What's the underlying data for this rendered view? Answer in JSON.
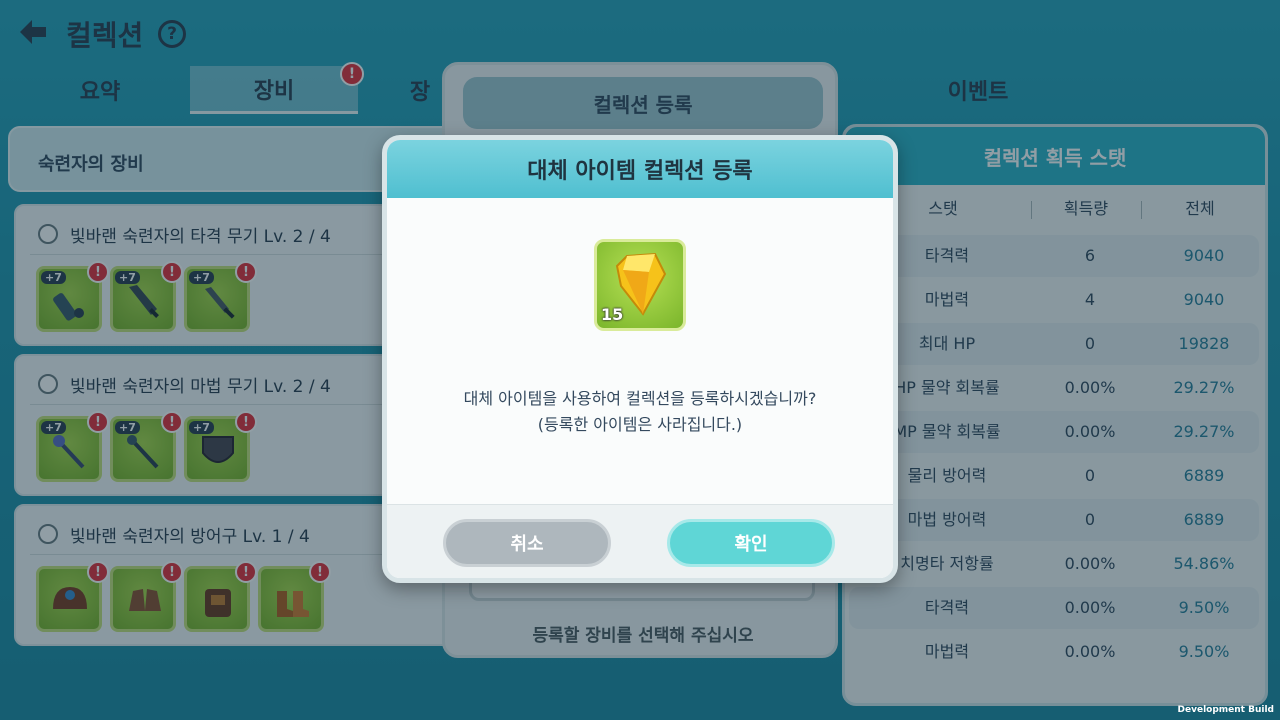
{
  "header": {
    "title": "컬렉션",
    "help_label": "?"
  },
  "tabs": [
    {
      "label": "요약",
      "active": false
    },
    {
      "label": "장비",
      "active": true,
      "badge": "!"
    },
    {
      "label": "장",
      "active": false
    },
    {
      "label": "이벤트",
      "active": false
    }
  ],
  "left_panel": {
    "section_title": "숙련자의 장비",
    "sets": [
      {
        "name": "빛바랜 숙련자의 타격 무기 Lv. 2 / 4",
        "items": [
          {
            "plus": "+7",
            "warn": "!",
            "icon": "cannon-icon"
          },
          {
            "plus": "+7",
            "warn": "!",
            "icon": "greatsword-icon"
          },
          {
            "plus": "+7",
            "warn": "!",
            "icon": "sword-icon"
          }
        ]
      },
      {
        "name": "빛바랜 숙련자의 마법 무기 Lv. 2 / 4",
        "items": [
          {
            "plus": "+7",
            "warn": "!",
            "icon": "staff-icon"
          },
          {
            "plus": "+7",
            "warn": "!",
            "icon": "wand-icon"
          },
          {
            "plus": "+7",
            "warn": "!",
            "icon": "shield-icon"
          }
        ]
      },
      {
        "name": "빛바랜 숙련자의 방어구 Lv. 1 / 4",
        "items": [
          {
            "warn": "!",
            "icon": "helmet-icon"
          },
          {
            "warn": "!",
            "icon": "gloves-icon"
          },
          {
            "warn": "!",
            "icon": "armor-icon"
          },
          {
            "warn": "!",
            "icon": "boots-icon"
          }
        ]
      }
    ]
  },
  "register_panel": {
    "title": "컬렉션 등록",
    "slot_text": "",
    "hint": "등록할 장비를 선택해 주십시오"
  },
  "stats_panel": {
    "title": "컬렉션 획득 스탯",
    "columns": [
      "스탯",
      "획득량",
      "전체"
    ],
    "rows": [
      {
        "stat": "타격력",
        "gain": "6",
        "total": "9040"
      },
      {
        "stat": "마법력",
        "gain": "4",
        "total": "9040"
      },
      {
        "stat": "최대 HP",
        "gain": "0",
        "total": "19828"
      },
      {
        "stat": "HP 물약 회복률",
        "gain": "0.00%",
        "total": "29.27%"
      },
      {
        "stat": "MP 물약 회복률",
        "gain": "0.00%",
        "total": "29.27%"
      },
      {
        "stat": "물리 방어력",
        "gain": "0",
        "total": "6889"
      },
      {
        "stat": "마법 방어력",
        "gain": "0",
        "total": "6889"
      },
      {
        "stat": "치명타 저항률",
        "gain": "0.00%",
        "total": "54.86%"
      },
      {
        "stat": "타격력",
        "gain": "0.00%",
        "total": "9.50%"
      },
      {
        "stat": "마법력",
        "gain": "0.00%",
        "total": "9.50%"
      }
    ]
  },
  "modal": {
    "title": "대체 아이템 컬렉션 등록",
    "item_count": "15",
    "item_icon": "crystal-shard-icon",
    "message_line1": "대체 아이템을 사용하여 컬렉션을 등록하시겠습니까?",
    "message_line2": "(등록한 아이템은 사라집니다.)",
    "cancel_label": "취소",
    "confirm_label": "확인"
  },
  "footer": {
    "build_label": "Development Build"
  },
  "colors": {
    "accent": "#4fbfd0",
    "confirm": "#5fd6d6",
    "cancel": "#aeb7bd",
    "badge": "#e2303b"
  }
}
